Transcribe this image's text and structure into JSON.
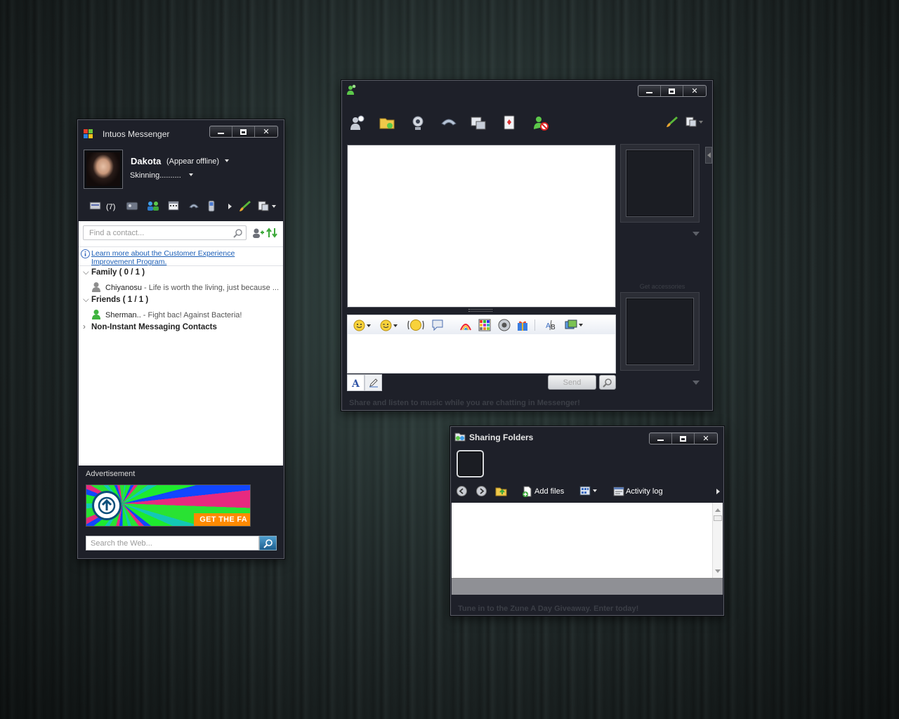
{
  "messenger": {
    "title": "Intuos Messenger",
    "user": {
      "name": "Dakota",
      "status": "(Appear offline)",
      "personal_message": "Skinning.........."
    },
    "toolbar": {
      "inbox_count": "(7)"
    },
    "search_placeholder": "Find a contact...",
    "info_link": "Learn more about the Customer Experience Improvement Program.",
    "groups": [
      {
        "label": "Family ( 0 / 1 )",
        "contacts": [
          {
            "name": "Chiyanosu",
            "message": " - Life is worth the living, just because ..."
          }
        ]
      },
      {
        "label": "Friends ( 1 / 1 )",
        "contacts": [
          {
            "name": "Sherman..",
            "message": " - Fight bac! Against Bacteria!"
          }
        ]
      },
      {
        "label": "Non-Instant Messaging Contacts",
        "contacts": []
      }
    ],
    "ad": {
      "label": "Advertisement",
      "cta": "GET THE FA"
    },
    "web_search_placeholder": "Search the Web..."
  },
  "conversation": {
    "send_label": "Send",
    "accessories_label": "Get accessories",
    "bottom_message": "Share and listen to music while you are chatting in Messenger!"
  },
  "sharing": {
    "title": "Sharing Folders",
    "add_files_label": "Add files",
    "activity_log_label": "Activity log",
    "bottom_message": "Tune in to the Zune A Day Giveaway. Enter today!"
  },
  "colors": {
    "window_bg": "#1e2029",
    "link": "#1c5fb7",
    "online": "#3fb43f",
    "offline": "#8e8e8e"
  }
}
